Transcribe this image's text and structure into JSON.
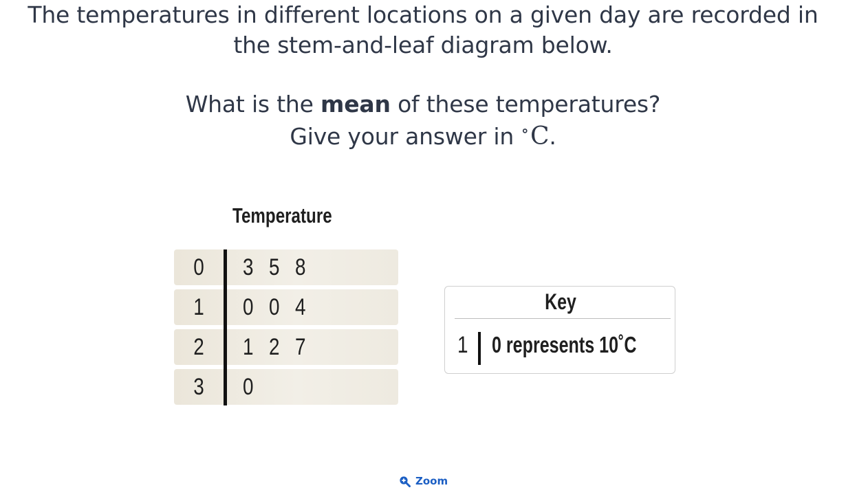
{
  "question": {
    "line1": "The temperatures in different locations on a given day are recorded in",
    "line2": "the stem-and-leaf diagram below.",
    "line3_pre": "What is the ",
    "line3_bold": "mean",
    "line3_post": " of these temperatures?",
    "line4_pre": "Give your answer in ",
    "line4_deg": "∘",
    "line4_unit": "C",
    "line4_post": "."
  },
  "diagram": {
    "title": "Temperature",
    "rows": [
      {
        "stem": "0",
        "leaves": "3 5 8"
      },
      {
        "stem": "1",
        "leaves": "0 0 4"
      },
      {
        "stem": "2",
        "leaves": "1 2 7"
      },
      {
        "stem": "3",
        "leaves": "0"
      }
    ]
  },
  "key": {
    "title": "Key",
    "stem": "1",
    "leaf_text": "0  represents 10˚C"
  },
  "zoom": {
    "label": "Zoom",
    "icon": "zoom-in-icon",
    "color": "#1c5fc4"
  }
}
